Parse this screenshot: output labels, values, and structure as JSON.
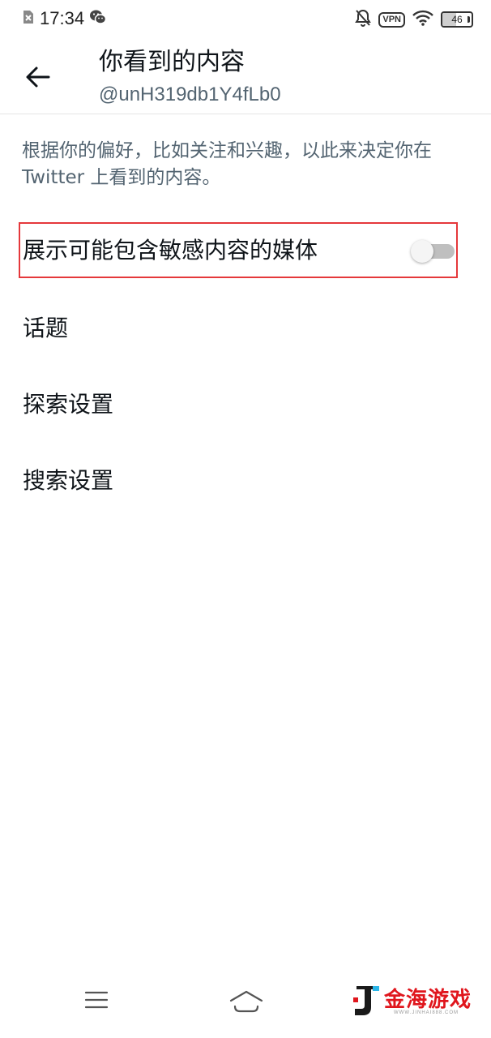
{
  "status_bar": {
    "time": "17:34",
    "vpn_label": "VPN",
    "battery_level": "46",
    "battery_fraction": 0.46,
    "left_icons": [
      "sim-off-icon",
      "wechat-icon"
    ],
    "right_icons": [
      "bell-muted-icon",
      "vpn-icon",
      "wifi-icon",
      "battery-icon"
    ]
  },
  "header": {
    "title": "你看到的内容",
    "subtitle": "@unH319db1Y4fLb0",
    "back_icon": "arrow-left-icon"
  },
  "description": "根据你的偏好，比如关注和兴趣，以此来决定你在 Twitter 上看到的内容。",
  "settings": {
    "sensitive_media": {
      "label": "展示可能包含敏感内容的媒体",
      "enabled": false
    },
    "items": [
      {
        "label": "话题"
      },
      {
        "label": "探索设置"
      },
      {
        "label": "搜索设置"
      }
    ]
  },
  "nav": {
    "icons": [
      "menu-icon",
      "home-icon"
    ]
  },
  "watermark": {
    "text": "金海游戏",
    "sub_text": "WWW.JINHAI888.COM"
  },
  "colors": {
    "highlight_border": "#e5383b",
    "secondary_text": "#536471",
    "primary_text": "#0f1419",
    "watermark_red": "#e0161d"
  }
}
